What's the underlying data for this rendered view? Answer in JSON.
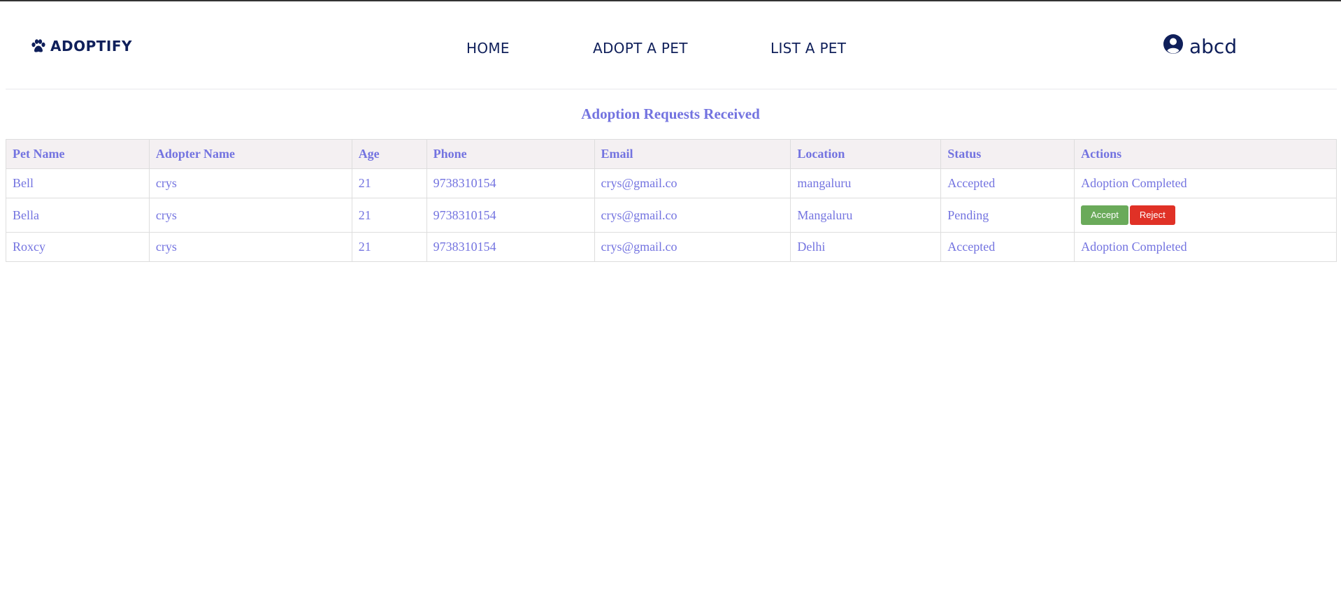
{
  "brand": {
    "name": "ADOPTIFY",
    "icon": "paw-icon",
    "color": "#0f1f5a"
  },
  "nav": {
    "home": "HOME",
    "adopt": "ADOPT A PET",
    "list": "LIST A PET"
  },
  "user": {
    "name": "abcd",
    "icon": "user-circle-icon"
  },
  "page": {
    "title": "Adoption Requests Received",
    "accent": "#7373e0"
  },
  "table": {
    "headers": [
      "Pet Name",
      "Adopter Name",
      "Age",
      "Phone",
      "Email",
      "Location",
      "Status",
      "Actions"
    ],
    "rows": [
      {
        "pet": "Bell",
        "adopter": "crys",
        "age": "21",
        "phone": "9738310154",
        "email": "crys@gmail.co",
        "location": "mangaluru",
        "status": "Accepted",
        "action": "Adoption Completed"
      },
      {
        "pet": "Bella",
        "adopter": "crys",
        "age": "21",
        "phone": "9738310154",
        "email": "crys@gmail.co",
        "location": "Mangaluru",
        "status": "Pending",
        "accept": "Accept",
        "reject": "Reject"
      },
      {
        "pet": "Roxcy",
        "adopter": "crys",
        "age": "21",
        "phone": "9738310154",
        "email": "crys@gmail.co",
        "location": "Delhi",
        "status": "Accepted",
        "action": "Adoption Completed"
      }
    ]
  },
  "colors": {
    "accept": "#6aaa5a",
    "reject": "#e03126",
    "header_bg": "#f4f0f2"
  }
}
